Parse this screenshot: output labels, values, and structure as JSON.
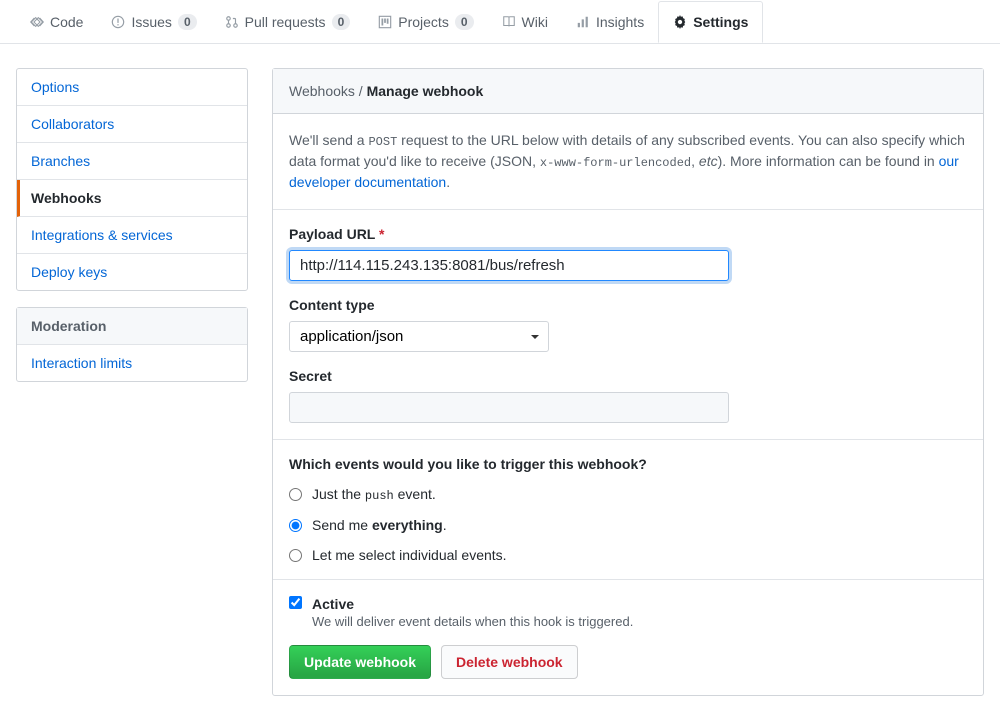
{
  "topnav": {
    "code": "Code",
    "issues": "Issues",
    "issues_count": "0",
    "pulls": "Pull requests",
    "pulls_count": "0",
    "projects": "Projects",
    "projects_count": "0",
    "wiki": "Wiki",
    "insights": "Insights",
    "settings": "Settings"
  },
  "sidebar": {
    "items": [
      "Options",
      "Collaborators",
      "Branches",
      "Webhooks",
      "Integrations & services",
      "Deploy keys"
    ],
    "moderation_heading": "Moderation",
    "moderation_items": [
      "Interaction limits"
    ]
  },
  "header": {
    "crumb": "Webhooks",
    "sep": " / ",
    "current": "Manage webhook"
  },
  "intro": {
    "p1a": "We'll send a ",
    "code1": "POST",
    "p1b": " request to the URL below with details of any subscribed events. You can also specify which data format you'd like to receive (JSON, ",
    "code2": "x-www-form-urlencoded",
    "p1c": ", ",
    "em": "etc",
    "p1d": "). More information can be found in ",
    "link": "our developer documentation",
    "p1e": "."
  },
  "form": {
    "payload_label": "Payload URL",
    "payload_value": "http://114.115.243.135:8081/bus/refresh",
    "content_type_label": "Content type",
    "content_type_value": "application/json",
    "secret_label": "Secret",
    "secret_value": ""
  },
  "events": {
    "title": "Which events would you like to trigger this webhook?",
    "opt1a": "Just the ",
    "opt1code": "push",
    "opt1b": " event.",
    "opt2a": "Send me ",
    "opt2b": "everything",
    "opt2c": ".",
    "opt3": "Let me select individual events.",
    "selected": 1
  },
  "active": {
    "label": "Active",
    "desc": "We will deliver event details when this hook is triggered.",
    "checked": true
  },
  "buttons": {
    "update": "Update webhook",
    "delete": "Delete webhook"
  }
}
